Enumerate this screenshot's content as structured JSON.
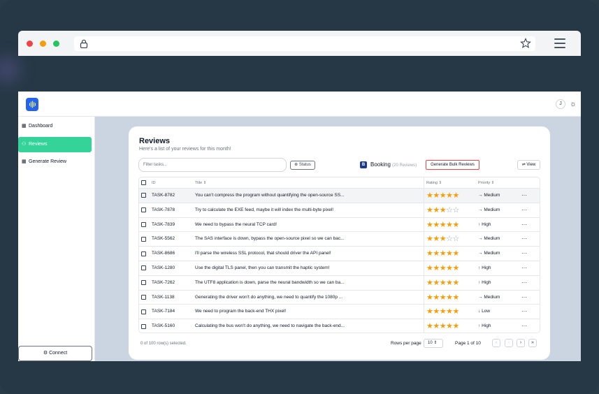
{
  "app": {
    "avatar_initial": "J",
    "sidebar": [
      {
        "label": "Dashboard",
        "icon": "grid-icon"
      },
      {
        "label": "Reviews",
        "icon": "user-icon",
        "active": true
      },
      {
        "label": "Generate Review",
        "icon": "grid-icon"
      }
    ],
    "connect_label": "Connect"
  },
  "reviews": {
    "title": "Reviews",
    "subtitle": "Here's a list of your reviews for this month!",
    "filter_placeholder": "Filter tasks...",
    "status_label": "Status",
    "booking_badge": "B",
    "booking_label": "Booking",
    "booking_count": "(20 Reviews)",
    "generate_label": "Generate Bulk Reviews",
    "view_label": "View",
    "columns": {
      "id": "ID",
      "title": "Title",
      "rating": "Rating",
      "priority": "Priority"
    },
    "rows": [
      {
        "id": "TASK-8782",
        "title": "You can't compress the program without quantifying the open-source SS...",
        "rating": 5,
        "priority": "Medium",
        "arrow": "→"
      },
      {
        "id": "TASK-7878",
        "title": "Try to calculate the EXE feed, maybe it will index the multi-byte pixel!",
        "rating": 3,
        "priority": "Medium",
        "arrow": "→"
      },
      {
        "id": "TASK-7839",
        "title": "We need to bypass the neural TCP card!",
        "rating": 5,
        "priority": "High",
        "arrow": "↑"
      },
      {
        "id": "TASK-5562",
        "title": "The SAS interface is down, bypass the open-source pixel so we can bac...",
        "rating": 3,
        "priority": "Medium",
        "arrow": "→"
      },
      {
        "id": "TASK-8686",
        "title": "I'll parse the wireless SSL protocol, that should driver the API panel!",
        "rating": 5,
        "priority": "Medium",
        "arrow": "→"
      },
      {
        "id": "TASK-1280",
        "title": "Use the digital TLS panel, then you can transmit the haptic system!",
        "rating": 5,
        "priority": "High",
        "arrow": "↑"
      },
      {
        "id": "TASK-7262",
        "title": "The UTF8 application is down, parse the neural bandwidth so we can ba...",
        "rating": 5,
        "priority": "High",
        "arrow": "↑"
      },
      {
        "id": "TASK-1138",
        "title": "Generating the driver won't do anything, we need to quantify the 1080p ...",
        "rating": 5,
        "priority": "Medium",
        "arrow": "→"
      },
      {
        "id": "TASK-7184",
        "title": "We need to program the back-end THX pixel!",
        "rating": 5,
        "priority": "Low",
        "arrow": "↓"
      },
      {
        "id": "TASK-5160",
        "title": "Calculating the bus won't do anything, we need to navigate the back-end...",
        "rating": 5,
        "priority": "High",
        "arrow": "↑"
      }
    ],
    "selected_text": "0 of 100 row(s) selected.",
    "rows_per_page_label": "Rows per page",
    "rows_per_page_value": "10",
    "page_text": "Page 1 of 10",
    "colors": {
      "star": "#f59e0b",
      "accent": "#34d399"
    }
  }
}
